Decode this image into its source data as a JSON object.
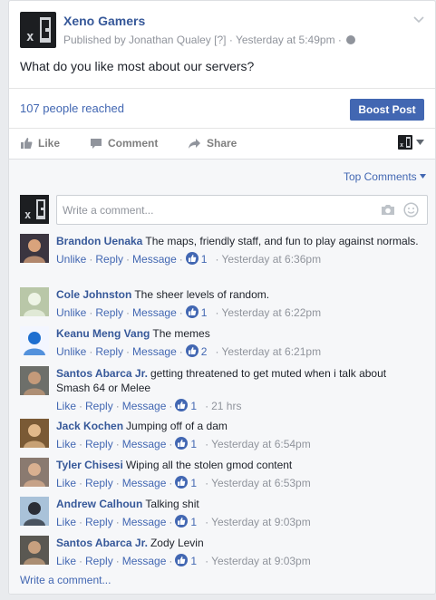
{
  "post": {
    "page_name": "Xeno Gamers",
    "published_by": "Published by Jonathan Qualey",
    "help_mark": "[?]",
    "separator": "·",
    "time": "Yesterday at 5:49pm",
    "text": "What do you like most about our servers?"
  },
  "reach": {
    "text": "107 people reached",
    "boost_label": "Boost Post"
  },
  "actions": {
    "like": "Like",
    "comment": "Comment",
    "share": "Share"
  },
  "comments_section": {
    "sort_label": "Top Comments",
    "composer_placeholder": "Write a comment...",
    "write_more": "Write a comment...",
    "items": [
      {
        "name": "Brandon Uenaka",
        "text": "The maps, friendly staff, and fun to play against normals.",
        "actions": [
          "Unlike",
          "Reply",
          "Message"
        ],
        "likes": "1",
        "time": "Yesterday at 6:36pm"
      },
      {
        "name": "Cole Johnston",
        "text": "The sheer levels of random.",
        "actions": [
          "Unlike",
          "Reply",
          "Message"
        ],
        "likes": "1",
        "time": "Yesterday at 6:22pm"
      },
      {
        "name": "Keanu Meng Vang",
        "text": "The memes",
        "actions": [
          "Unlike",
          "Reply",
          "Message"
        ],
        "likes": "2",
        "time": "Yesterday at 6:21pm"
      },
      {
        "name": "Santos Abarca Jr.",
        "text": "getting threatened to get muted when i talk about Smash 64 or Melee",
        "actions": [
          "Like",
          "Reply",
          "Message"
        ],
        "likes": "1",
        "time": "21 hrs"
      },
      {
        "name": "Jack Kochen",
        "text": "Jumping off of a dam",
        "actions": [
          "Like",
          "Reply",
          "Message"
        ],
        "likes": "1",
        "time": "Yesterday at 6:54pm"
      },
      {
        "name": "Tyler Chisesi",
        "text": "Wiping all the stolen gmod content",
        "actions": [
          "Like",
          "Reply",
          "Message"
        ],
        "likes": "1",
        "time": "Yesterday at 6:53pm"
      },
      {
        "name": "Andrew Calhoun",
        "text": "Talking shit",
        "actions": [
          "Like",
          "Reply",
          "Message"
        ],
        "likes": "1",
        "time": "Yesterday at 9:03pm"
      },
      {
        "name": "Santos Abarca Jr.",
        "text": "Zody Levin",
        "actions": [
          "Like",
          "Reply",
          "Message"
        ],
        "likes": "1",
        "time": "Yesterday at 9:03pm"
      }
    ]
  },
  "colors": {
    "link": "#365899",
    "accent": "#4267b2",
    "muted": "#90949c",
    "background": "#e9ebee"
  },
  "icons": [
    "chevron-down-icon",
    "globe-icon",
    "thumbs-up-icon",
    "speech-bubble-icon",
    "share-arrow-icon",
    "camera-icon",
    "emoji-icon",
    "like-reaction-icon"
  ]
}
